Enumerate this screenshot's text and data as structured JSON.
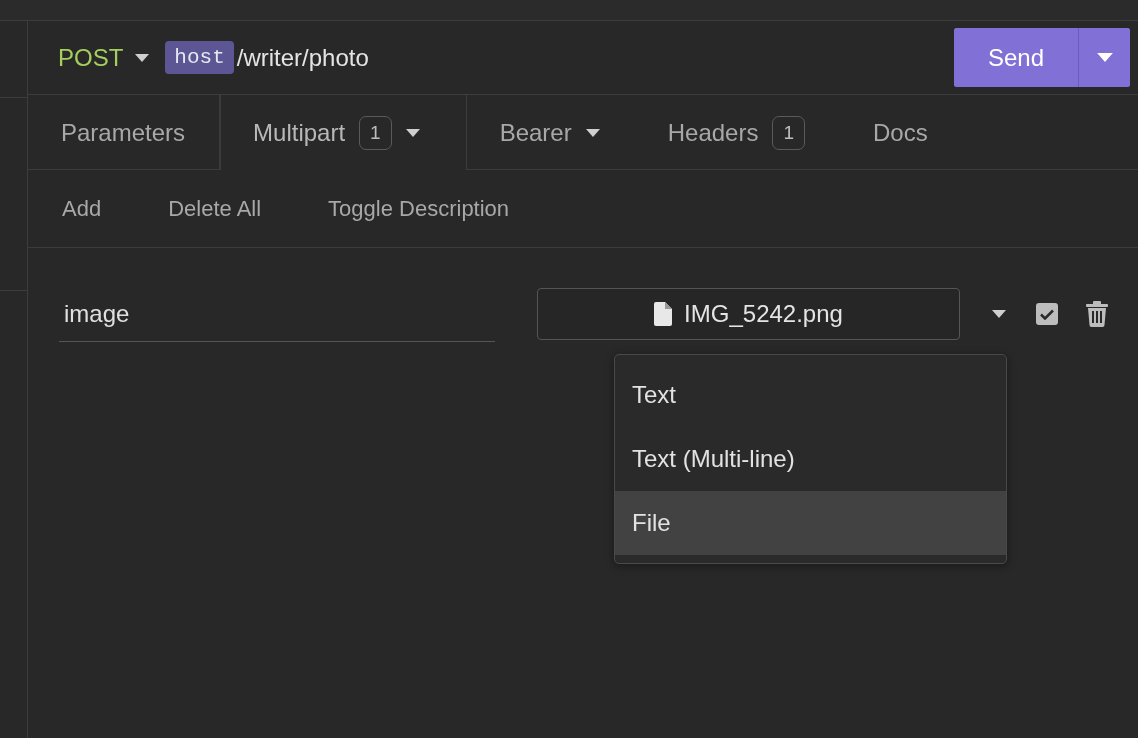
{
  "request": {
    "method": "POST",
    "url_host": "host",
    "url_path": "/writer/photo",
    "send": "Send"
  },
  "tabs": [
    {
      "label": "Parameters",
      "selected": false
    },
    {
      "label": "Multipart",
      "count": "1",
      "dropdown": true,
      "selected": true
    },
    {
      "label": "Bearer",
      "dropdown": true,
      "selected": false
    },
    {
      "label": "Headers",
      "count": "1",
      "selected": false
    },
    {
      "label": "Docs",
      "selected": false
    }
  ],
  "actions": [
    "Add",
    "Delete All",
    "Toggle Description"
  ],
  "params": [
    {
      "name": "image",
      "file": "IMG_5242.png",
      "enabled": true
    }
  ],
  "type_menu": [
    {
      "label": "Text",
      "selected": false
    },
    {
      "label": "Text (Multi-line)",
      "selected": false
    },
    {
      "label": "File",
      "selected": true
    }
  ]
}
